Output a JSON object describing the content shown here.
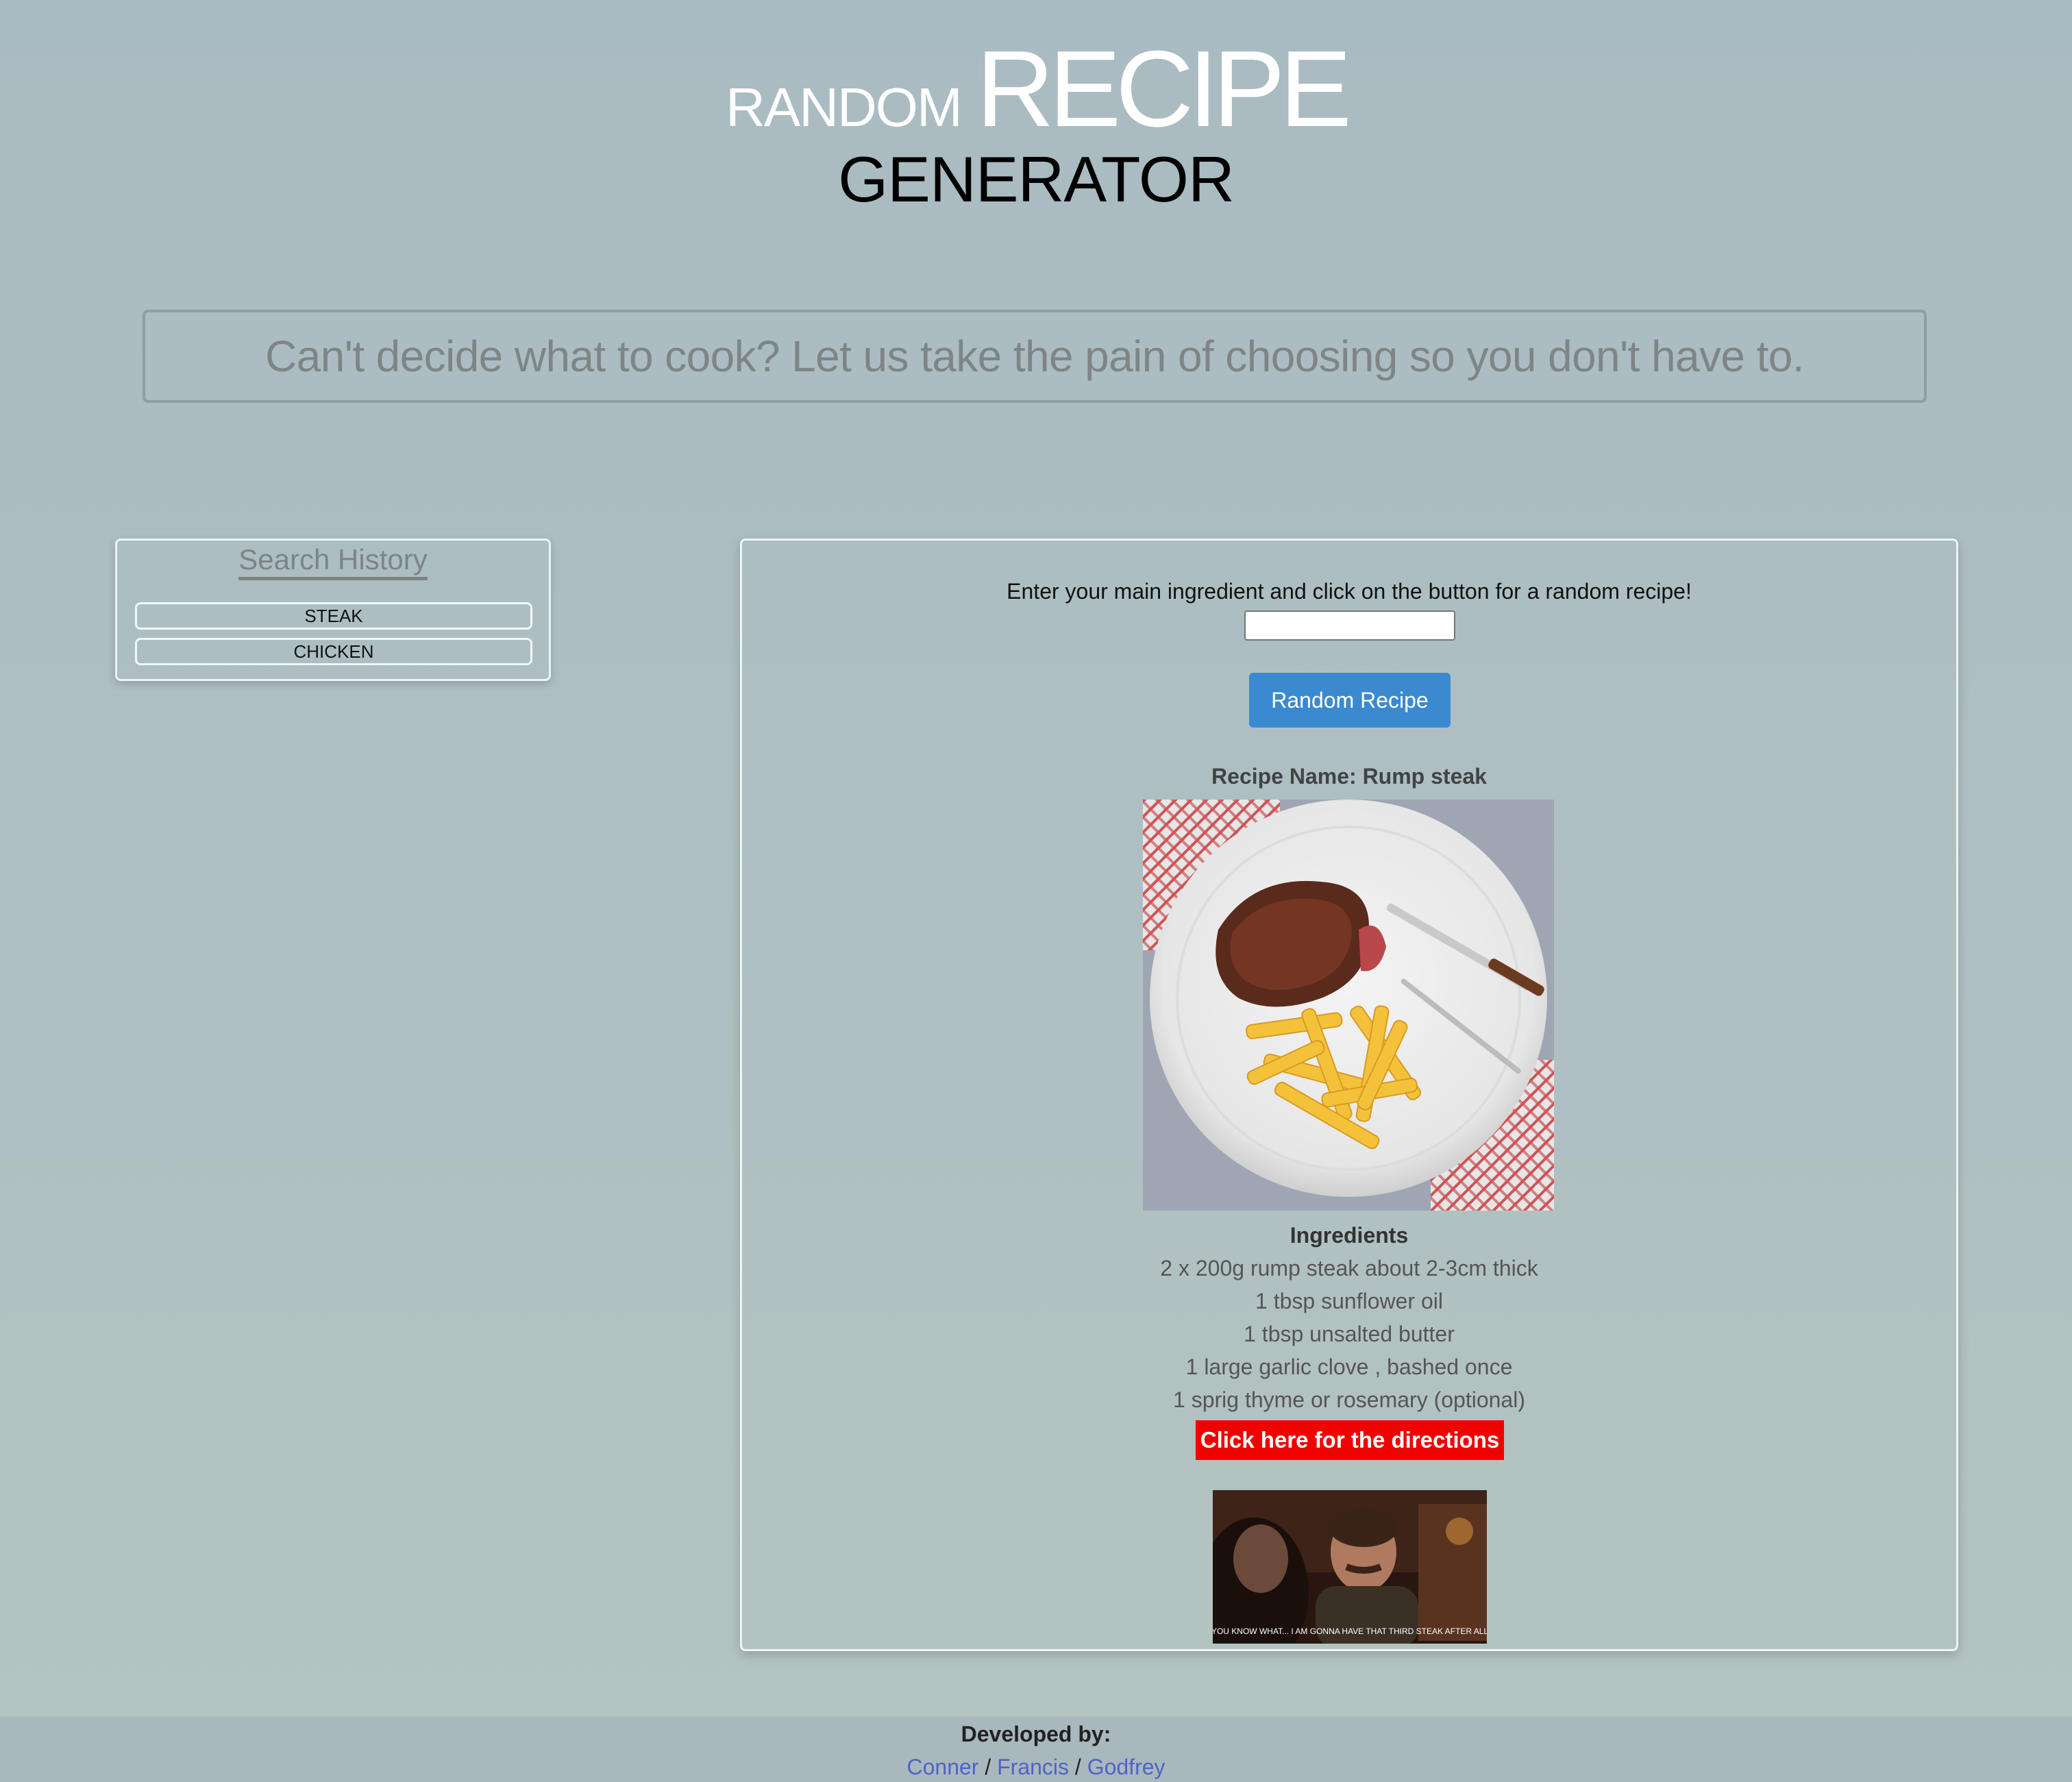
{
  "header": {
    "title_random": "RANDOM",
    "title_recipe": "RECIPE",
    "title_generator": "GENERATOR"
  },
  "tagline": "Can't decide what to cook? Let us take the pain of choosing so you don't have to.",
  "search_history": {
    "title": "Search History",
    "items": [
      "STEAK",
      "CHICKEN"
    ]
  },
  "main": {
    "instructions": "Enter your main ingredient and click on the button for a random recipe!",
    "input_value": "",
    "button_label": "Random Recipe",
    "recipe_name": "Recipe Name: Rump steak",
    "ingredients_heading": "Ingredients",
    "ingredients": [
      "2 x 200g rump steak about 2-3cm thick",
      "1 tbsp sunflower oil",
      "1 tbsp unsalted butter",
      "1 large garlic clove , bashed once",
      "1 sprig thyme or rosemary (optional)"
    ],
    "directions_link": "Click here for the directions",
    "gif_caption": "YOU KNOW WHAT... I AM GONNA HAVE THAT THIRD STEAK AFTER ALL"
  },
  "footer": {
    "heading": "Developed by:",
    "developers": [
      "Conner",
      "Francis",
      "Godfrey"
    ],
    "separator": "/"
  },
  "colors": {
    "accent_button": "#3b8ad0",
    "directions_bg": "#f20000",
    "link": "#4f63c6"
  }
}
